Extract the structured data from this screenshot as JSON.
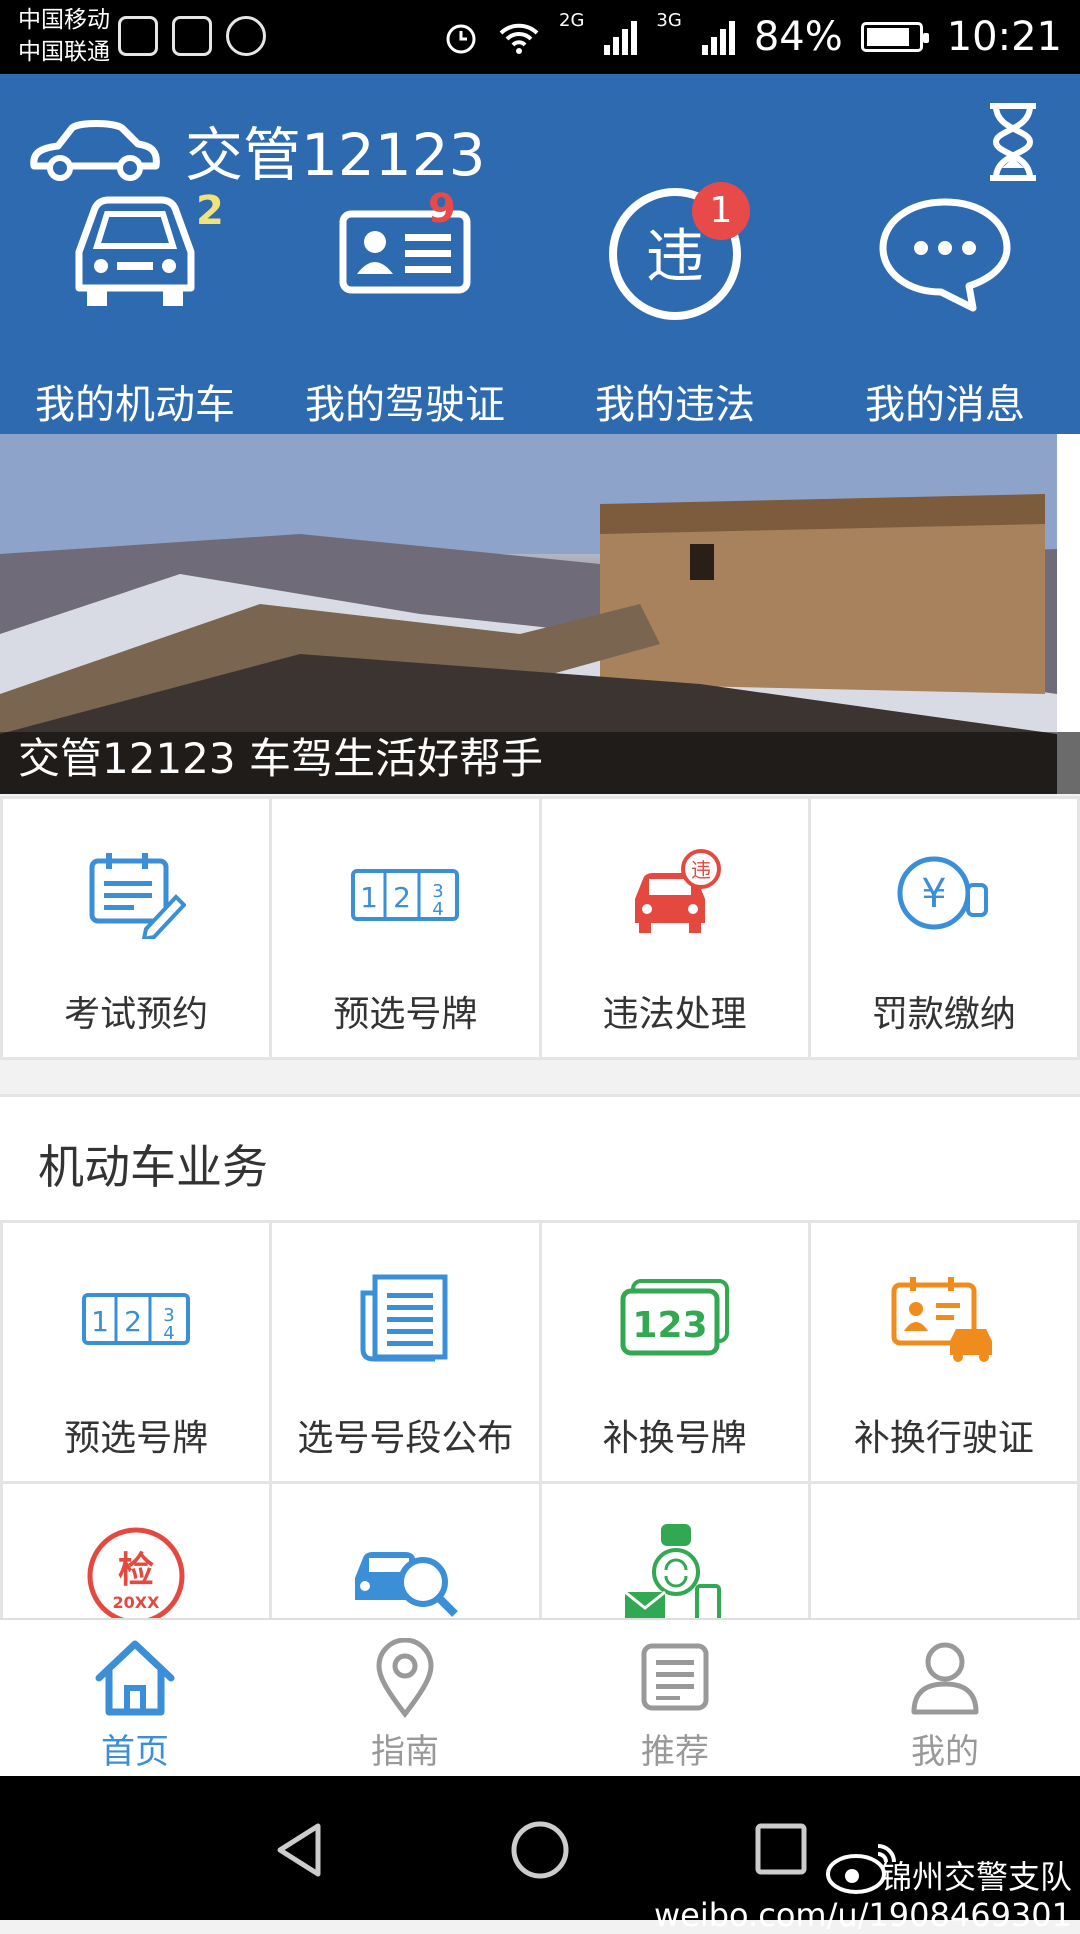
{
  "status_bar": {
    "carrier_1": "中国移动",
    "carrier_2": "中国联通",
    "signal_1": "2G",
    "signal_2": "3G",
    "battery": "84%",
    "battery_level": 0.84,
    "time": "10:21"
  },
  "header": {
    "title": "交管12123",
    "quick_items": [
      {
        "label": "我的机动车",
        "count": "2",
        "icon": "car-icon"
      },
      {
        "label": "我的驾驶证",
        "count": "9",
        "icon": "license-card-icon"
      },
      {
        "label": "我的违法",
        "count": "1",
        "icon": "violation-icon"
      },
      {
        "label": "我的消息",
        "count": "",
        "icon": "message-bubble-icon"
      }
    ]
  },
  "banner": {
    "caption": "交管12123 车驾生活好帮手"
  },
  "top_services": [
    {
      "label": "考试预约",
      "icon": "exam-calendar-icon"
    },
    {
      "label": "预选号牌",
      "icon": "plate-select-icon"
    },
    {
      "label": "违法处理",
      "icon": "violation-car-icon"
    },
    {
      "label": "罚款缴纳",
      "icon": "fine-payment-icon"
    }
  ],
  "vehicle_section": {
    "title": "机动车业务",
    "items": [
      {
        "label": "预选号牌",
        "icon": "plate-select-icon"
      },
      {
        "label": "选号号段公布",
        "icon": "number-list-icon"
      },
      {
        "label": "补换号牌",
        "icon": "plate-123-icon"
      },
      {
        "label": "补换行驶证",
        "icon": "driving-permit-icon"
      },
      {
        "label": "",
        "icon": "inspection-stamp-icon",
        "stamp_text": "检",
        "stamp_year": "20XX"
      },
      {
        "label": "",
        "icon": "car-search-icon"
      },
      {
        "label": "",
        "icon": "contact-exchange-icon"
      },
      {
        "label": "",
        "icon": ""
      }
    ]
  },
  "bottom_nav": [
    {
      "label": "首页",
      "icon": "home-icon",
      "active": true
    },
    {
      "label": "指南",
      "icon": "location-pin-icon",
      "active": false
    },
    {
      "label": "推荐",
      "icon": "list-doc-icon",
      "active": false
    },
    {
      "label": "我的",
      "icon": "user-icon",
      "active": false
    }
  ],
  "watermark": {
    "name": "锦州交警支队",
    "url": "weibo.com/u/1908469301"
  },
  "colors": {
    "brand_blue": "#2d6ab0",
    "count_yellow": "#f2e27a",
    "count_red": "#e84a4a",
    "icon_blue": "#3a8fd6",
    "icon_red": "#e5483f",
    "icon_green": "#32a852",
    "icon_orange": "#f08c1e",
    "nav_active": "#3a8fd6",
    "nav_inactive": "#999999"
  }
}
